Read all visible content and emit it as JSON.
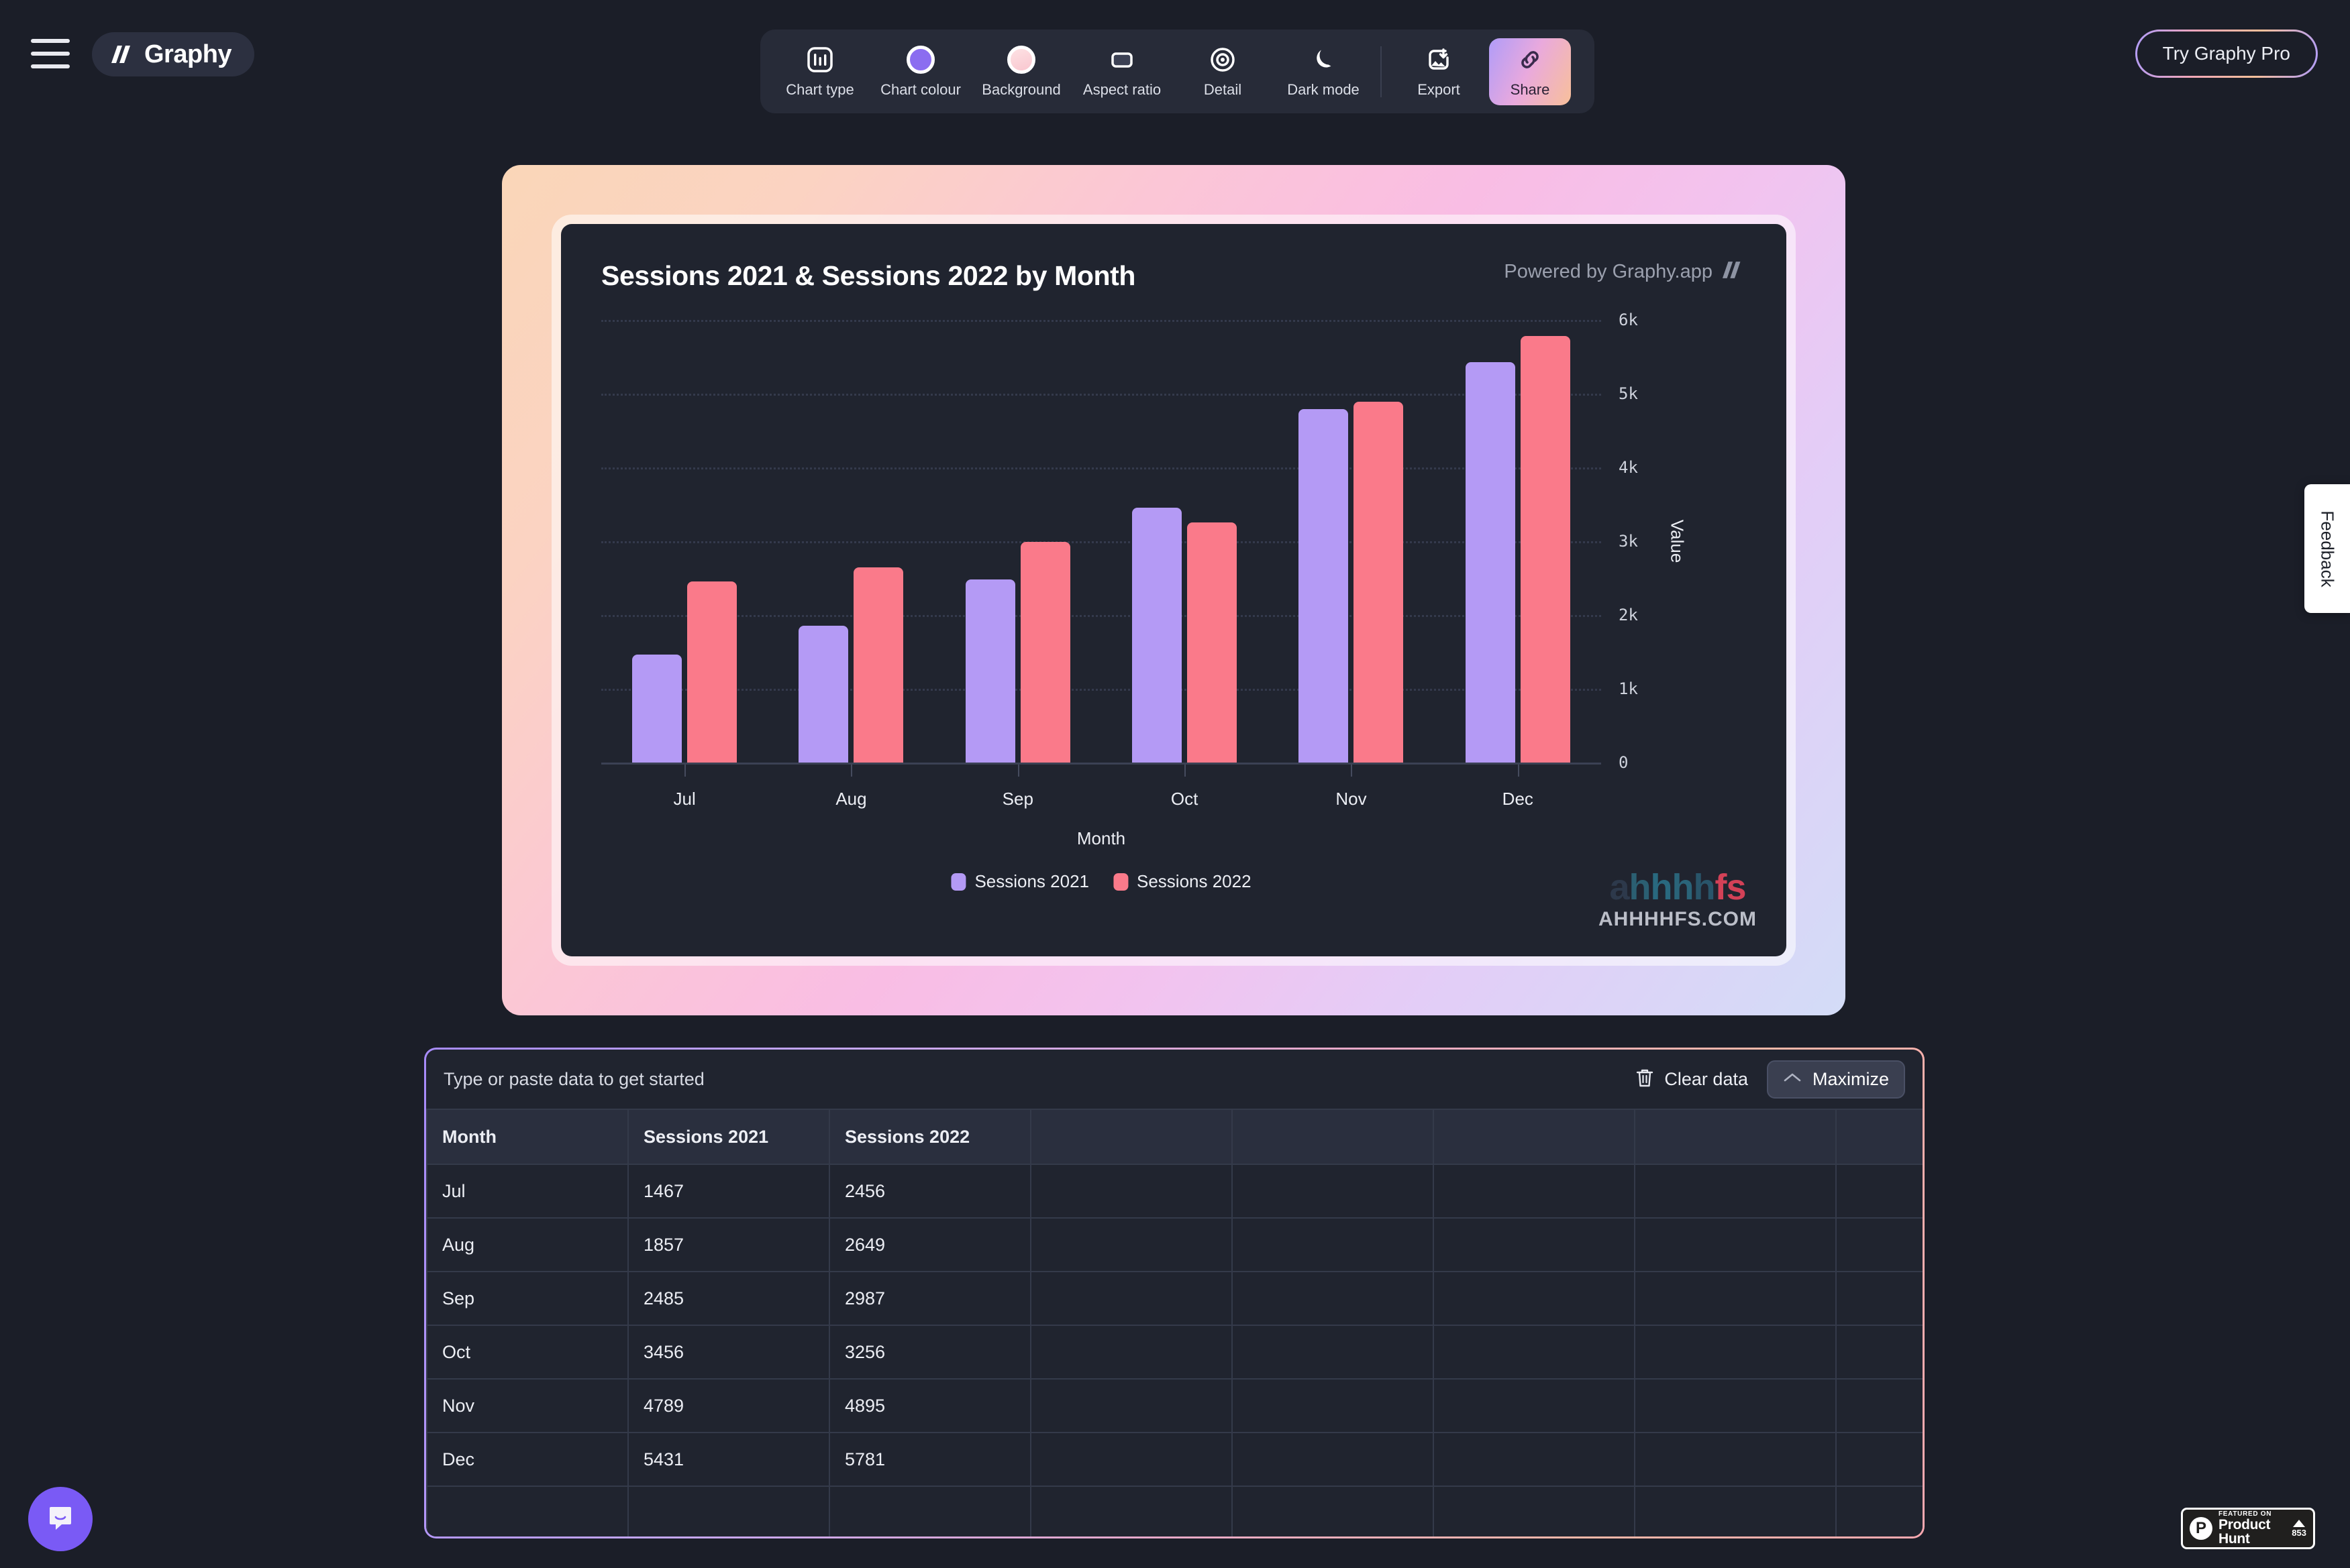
{
  "app": {
    "logo_text": "Graphy",
    "menu_icon": "hamburger-menu-icon",
    "try_pro_label": "Try Graphy Pro"
  },
  "toolbar": {
    "items": [
      {
        "label": "Chart type",
        "icon": "bar-chart-icon"
      },
      {
        "label": "Chart colour",
        "icon": "color-circle-icon",
        "color": "#8b6df0"
      },
      {
        "label": "Background",
        "icon": "background-circle-icon",
        "color": "#fad7dc"
      },
      {
        "label": "Aspect ratio",
        "icon": "rectangle-icon"
      },
      {
        "label": "Detail",
        "icon": "target-icon"
      },
      {
        "label": "Dark mode",
        "icon": "moon-icon"
      },
      {
        "label": "Export",
        "icon": "export-image-icon"
      },
      {
        "label": "Share",
        "icon": "link-icon"
      }
    ]
  },
  "chart_card": {
    "powered_by": "Powered by Graphy.app",
    "powered_icon": "graphy-slashes-icon",
    "watermark_top": "ahhhhfs",
    "watermark_bottom": "AHHHHFS.COM"
  },
  "chart_data": {
    "type": "bar",
    "title": "Sessions 2021 & Sessions 2022 by Month",
    "xlabel": "Month",
    "ylabel": "Value",
    "categories": [
      "Jul",
      "Aug",
      "Sep",
      "Oct",
      "Nov",
      "Dec"
    ],
    "series": [
      {
        "name": "Sessions 2021",
        "color": "#b49af5",
        "values": [
          1467,
          1857,
          2485,
          3456,
          4789,
          5431
        ]
      },
      {
        "name": "Sessions 2022",
        "color": "#fa7a8a",
        "values": [
          2456,
          2649,
          2987,
          3256,
          4895,
          5781
        ]
      }
    ],
    "ylim": [
      0,
      6000
    ],
    "yticks": [
      "0",
      "1k",
      "2k",
      "3k",
      "4k",
      "5k",
      "6k"
    ],
    "grid": true,
    "legend_position": "bottom"
  },
  "data_panel": {
    "hint": "Type or paste data to get started",
    "clear_label": "Clear data",
    "clear_icon": "trash-icon",
    "maximize_label": "Maximize",
    "maximize_icon": "chevron-up-icon",
    "columns": [
      "Month",
      "Sessions 2021",
      "Sessions 2022",
      "",
      "",
      "",
      "",
      ""
    ],
    "rows": [
      [
        "Jul",
        "1467",
        "2456",
        "",
        "",
        "",
        "",
        ""
      ],
      [
        "Aug",
        "1857",
        "2649",
        "",
        "",
        "",
        "",
        ""
      ],
      [
        "Sep",
        "2485",
        "2987",
        "",
        "",
        "",
        "",
        ""
      ],
      [
        "Oct",
        "3456",
        "3256",
        "",
        "",
        "",
        "",
        ""
      ],
      [
        "Nov",
        "4789",
        "4895",
        "",
        "",
        "",
        "",
        ""
      ],
      [
        "Dec",
        "5431",
        "5781",
        "",
        "",
        "",
        "",
        ""
      ],
      [
        "",
        "",
        "",
        "",
        "",
        "",
        "",
        ""
      ]
    ]
  },
  "overlays": {
    "feedback_label": "Feedback",
    "chat_icon": "chat-bubble-icon",
    "product_hunt": {
      "featured_text": "FEATURED ON",
      "name": "Product Hunt",
      "count": "853"
    }
  },
  "colors": {
    "series_1": "#b49af5",
    "series_2": "#fa7a8a",
    "background": "#1b1e28",
    "card": "#20242f"
  }
}
